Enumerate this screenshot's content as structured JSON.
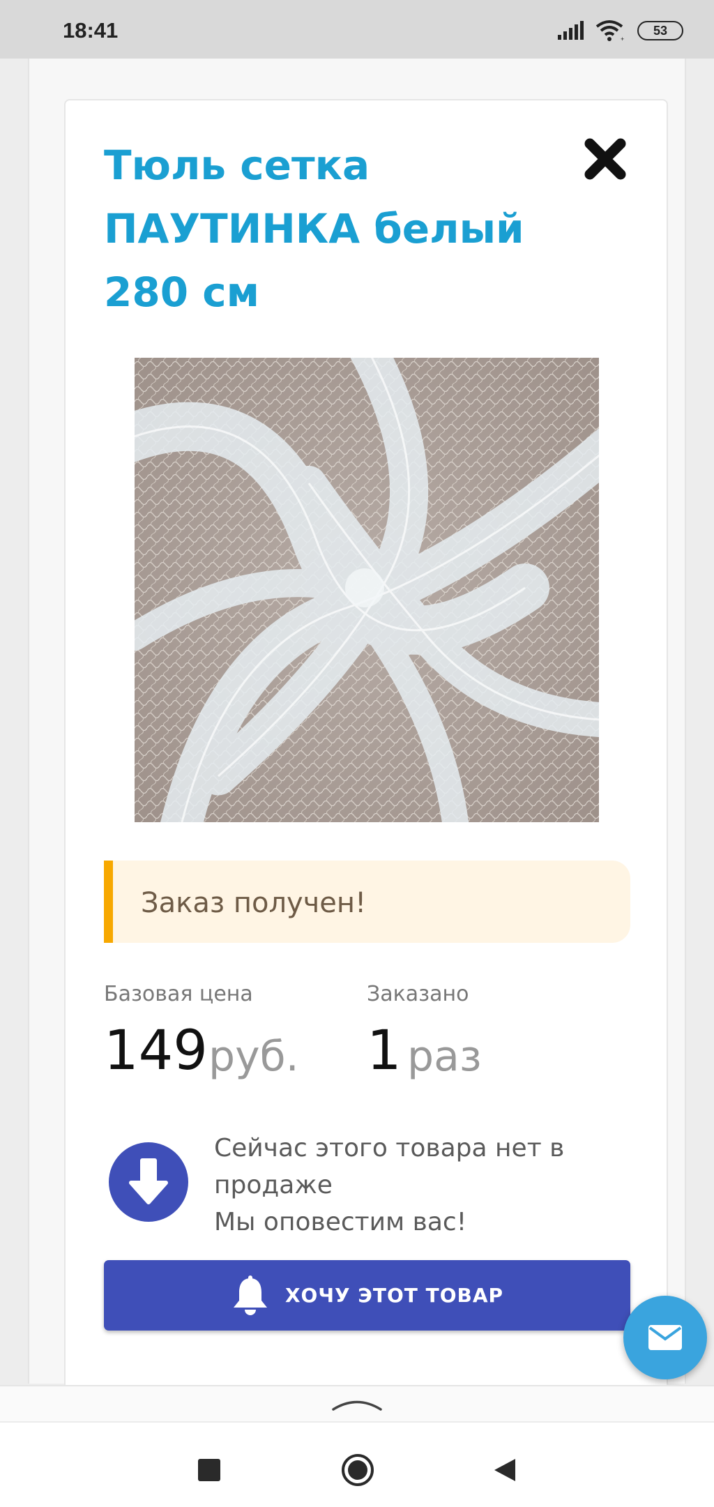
{
  "status_bar": {
    "time": "18:41",
    "battery": "53",
    "icons": [
      "signal-icon",
      "wifi-icon",
      "battery-icon"
    ]
  },
  "product": {
    "title": "Тюль сетка ПАУТИНКА белый 280 см",
    "image_alt": "white spider-web mesh tulle fabric swirl"
  },
  "alert": {
    "text": "Заказ получен!"
  },
  "stats": {
    "base_price_label": "Базовая цена",
    "base_price_value": "149",
    "base_price_unit": "руб.",
    "ordered_label": "Заказано",
    "ordered_value": "1",
    "ordered_unit": "раз"
  },
  "notify": {
    "line1": "Сейчас этого товара нет в продаже",
    "line2": "Мы оповестим вас!"
  },
  "actions": {
    "want_label": "ХОЧУ ЭТОТ ТОВАР"
  },
  "colors": {
    "title": "#1a9fd2",
    "primary": "#3f4fb8",
    "alert_bg": "#fff5e4",
    "alert_accent": "#f7a800",
    "fab": "#3aa4de"
  }
}
